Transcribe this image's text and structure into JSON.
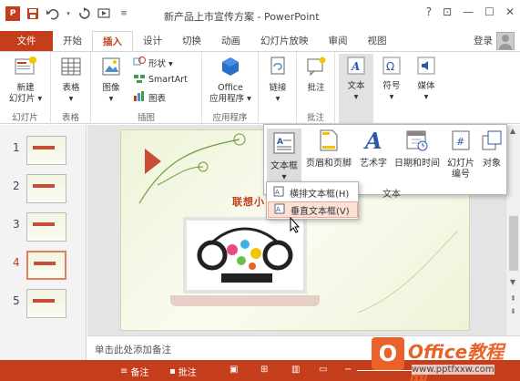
{
  "window": {
    "title": "新产品上市宣传方案 - PowerPoint",
    "help": "?",
    "controls": [
      "?",
      "⊡",
      "—",
      "☐",
      "✕"
    ]
  },
  "tabs": [
    "文件",
    "开始",
    "插入",
    "设计",
    "切换",
    "动画",
    "幻灯片放映",
    "审阅",
    "视图"
  ],
  "login": "登录",
  "ribbon": {
    "new_slide": "新建\n幻灯片",
    "new_slide_l1": "新建",
    "new_slide_l2": "幻灯片 ▾",
    "group_slides": "幻灯片",
    "table": "表格",
    "group_table": "表格",
    "image": "图像",
    "shapes": "形状 ▾",
    "smartart": "SmartArt",
    "chart": "图表",
    "group_illus": "插图",
    "office_l1": "Office",
    "office_l2": "应用程序 ▾",
    "group_apps": "应用程序",
    "link": "链接",
    "comment": "批注",
    "group_comment": "批注",
    "text": "文本",
    "symbol": "符号",
    "media": "媒体"
  },
  "insert_panel": {
    "textbox": "文本框",
    "header_footer": "页眉和页脚",
    "wordart": "艺术字",
    "datetime": "日期和时间",
    "slide_number_l1": "幻灯片",
    "slide_number_l2": "编号",
    "object": "对象",
    "text_label": "文本"
  },
  "textbox_menu": {
    "horizontal": "横排文本框(H)",
    "vertical": "垂直文本框(V)"
  },
  "thumbnails": [
    "1",
    "2",
    "3",
    "4",
    "5"
  ],
  "selected_slide": "4",
  "slide": {
    "title": "联想小"
  },
  "notes_placeholder": "单击此处添加备注",
  "status": {
    "notes": "备注",
    "comments": "批注"
  },
  "watermark": {
    "title": "Office教程网",
    "icon": "O",
    "url": "www.pptfxxw.com"
  },
  "colors": {
    "accent": "#c43e1c",
    "status_bar": "#c43e1c"
  }
}
